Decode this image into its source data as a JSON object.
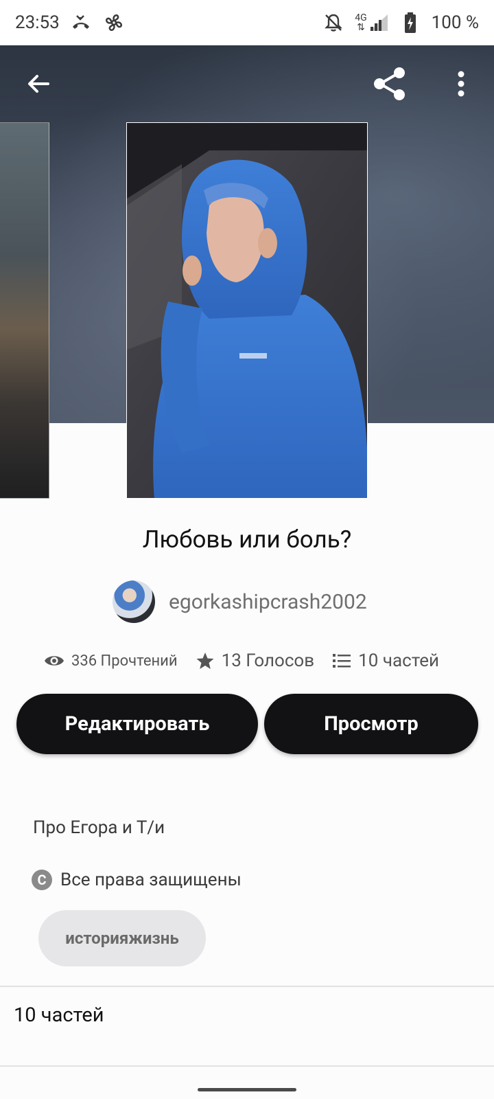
{
  "status_bar": {
    "time": "23:53",
    "network": "4G",
    "battery": "100 %",
    "icons": [
      "missed-call-icon",
      "fan-icon",
      "notifications-off-icon",
      "signal-icon",
      "battery-icon"
    ]
  },
  "toolbar": {
    "back_icon": "arrow-back-icon",
    "share_icon": "share-icon",
    "more_icon": "more-vert-icon"
  },
  "story": {
    "title": "Любовь или боль?",
    "author": "egorkashipcrash2002",
    "stats": {
      "reads": "336 Прочтений",
      "votes": "13 Голосов",
      "parts": "10 частей"
    },
    "description": "Про Егора и Т/и",
    "rights": "Все права защищены",
    "tag": "историяжизнь"
  },
  "actions": {
    "edit_label": "Редактировать",
    "view_label": "Просмотр"
  },
  "parts_section": {
    "title": "10 частей"
  },
  "colors": {
    "button_bg": "#121214",
    "tag_bg": "#e6e6e8",
    "cover_hoodie": "#3f7fd8"
  }
}
